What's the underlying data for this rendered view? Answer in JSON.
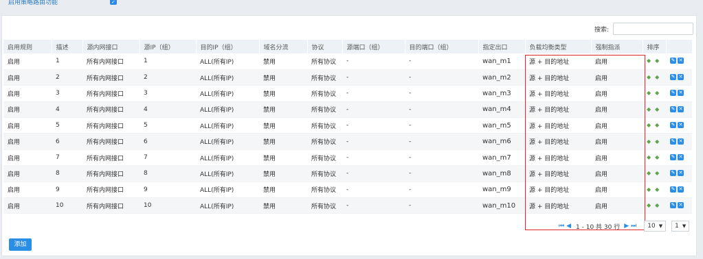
{
  "top": {
    "enable_label": "启用策略路由功能",
    "checkbox_mark": "✓"
  },
  "search": {
    "label": "搜索:",
    "value": "",
    "placeholder": ""
  },
  "table": {
    "headers": [
      "启用规则",
      "描述",
      "源内网接口",
      "源IP（组）",
      "目的IP（组）",
      "域名分流",
      "协议",
      "源端口（组）",
      "目的端口（组）",
      "指定出口",
      "负载均衡类型",
      "强制指派",
      "排序",
      ""
    ],
    "rows": [
      [
        "启用",
        "1",
        "所有内网接口",
        "1",
        "ALL(所有IP)",
        "禁用",
        "所有协议",
        "-",
        "-",
        "wan_m1",
        "源 + 目的地址",
        "启用"
      ],
      [
        "启用",
        "2",
        "所有内网接口",
        "2",
        "ALL(所有IP)",
        "禁用",
        "所有协议",
        "-",
        "-",
        "wan_m2",
        "源 + 目的地址",
        "启用"
      ],
      [
        "启用",
        "3",
        "所有内网接口",
        "3",
        "ALL(所有IP)",
        "禁用",
        "所有协议",
        "-",
        "-",
        "wan_m3",
        "源 + 目的地址",
        "启用"
      ],
      [
        "启用",
        "4",
        "所有内网接口",
        "4",
        "ALL(所有IP)",
        "禁用",
        "所有协议",
        "-",
        "-",
        "wan_m4",
        "源 + 目的地址",
        "启用"
      ],
      [
        "启用",
        "5",
        "所有内网接口",
        "5",
        "ALL(所有IP)",
        "禁用",
        "所有协议",
        "-",
        "-",
        "wan_m5",
        "源 + 目的地址",
        "启用"
      ],
      [
        "启用",
        "6",
        "所有内网接口",
        "6",
        "ALL(所有IP)",
        "禁用",
        "所有协议",
        "-",
        "-",
        "wan_m6",
        "源 + 目的地址",
        "启用"
      ],
      [
        "启用",
        "7",
        "所有内网接口",
        "7",
        "ALL(所有IP)",
        "禁用",
        "所有协议",
        "-",
        "-",
        "wan_m7",
        "源 + 目的地址",
        "启用"
      ],
      [
        "启用",
        "8",
        "所有内网接口",
        "8",
        "ALL(所有IP)",
        "禁用",
        "所有协议",
        "-",
        "-",
        "wan_m8",
        "源 + 目的地址",
        "启用"
      ],
      [
        "启用",
        "9",
        "所有内网接口",
        "9",
        "ALL(所有IP)",
        "禁用",
        "所有协议",
        "-",
        "-",
        "wan_m9",
        "源 + 目的地址",
        "启用"
      ],
      [
        "启用",
        "10",
        "所有内网接口",
        "10",
        "ALL(所有IP)",
        "禁用",
        "所有协议",
        "-",
        "-",
        "wan_m10",
        "源 + 目的地址",
        "启用"
      ]
    ],
    "row_icons": {
      "up": "up-arrow-icon",
      "down": "down-arrow-icon",
      "edit": "edit-icon",
      "delete": "delete-icon"
    }
  },
  "pager": {
    "info": "1 - 10 共 30 行",
    "page_size": "10",
    "page": "1",
    "first_icon": "first-page-icon",
    "prev_icon": "prev-page-icon",
    "next_icon": "next-page-icon",
    "last_icon": "last-page-icon"
  },
  "actions": {
    "add_label": "添加"
  },
  "colors": {
    "accent": "#2a8ee6",
    "highlight": "#e0262d",
    "arrow": "#5fa34a"
  }
}
